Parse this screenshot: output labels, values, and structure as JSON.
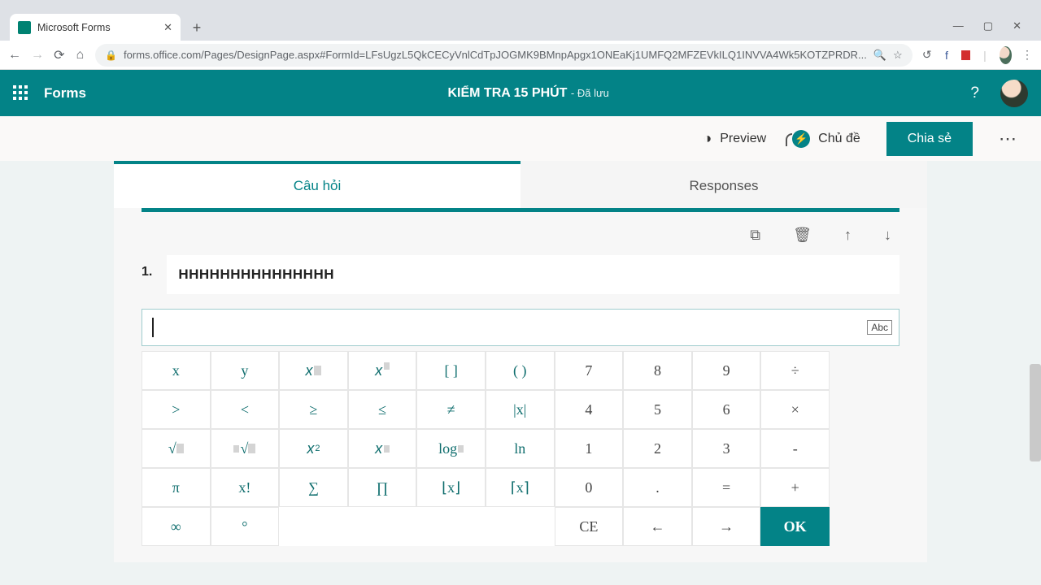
{
  "browser": {
    "tab_title": "Microsoft Forms",
    "url": "forms.office.com/Pages/DesignPage.aspx#FormId=LFsUgzL5QkCECyVnlCdTpJOGMK9BMnpApgx1ONEaKj1UMFQ2MFZEVkILQ1INVVA4Wk5KOTZPRDR..."
  },
  "app": {
    "name": "Forms",
    "form_title": "KIỂM TRA 15 PHÚT",
    "saved_label": "- Đã lưu"
  },
  "actions": {
    "preview": "Preview",
    "theme": "Chủ đề",
    "share": "Chia sẻ"
  },
  "tabs": {
    "questions": "Câu hỏi",
    "responses": "Responses"
  },
  "question": {
    "number": "1.",
    "title": "HHHHHHHHHHHHHHH",
    "abc_chip": "Abc"
  },
  "keys": {
    "r0": [
      "x",
      "y",
      "x▫",
      "x▫",
      "[ ]",
      "( )",
      "7",
      "8",
      "9",
      "÷"
    ],
    "r1": [
      ">",
      "<",
      "≥",
      "≤",
      "≠",
      "|x|",
      "4",
      "5",
      "6",
      "×"
    ],
    "r2": [
      "√▫",
      "▫√▫",
      "x²",
      "x▫",
      "log▫",
      "ln",
      "1",
      "2",
      "3",
      "-"
    ],
    "r3": [
      "π",
      "x!",
      "∑",
      "∏",
      "⌊x⌋",
      "⌈x⌉",
      "0",
      ".",
      "=",
      "+"
    ],
    "r4": [
      "∞",
      "°",
      "",
      "",
      "",
      "",
      "CE",
      "←",
      "→",
      "OK"
    ]
  },
  "key_names": {
    "r0": [
      "var-x",
      "var-y",
      "x-sub",
      "x-sup",
      "brackets",
      "parens",
      "digit-7",
      "digit-8",
      "digit-9",
      "divide"
    ],
    "r1": [
      "gt",
      "lt",
      "gte",
      "lte",
      "neq",
      "abs",
      "digit-4",
      "digit-5",
      "digit-6",
      "multiply"
    ],
    "r2": [
      "sqrt",
      "nth-root",
      "x-squared",
      "x-power",
      "log",
      "ln",
      "digit-1",
      "digit-2",
      "digit-3",
      "minus"
    ],
    "r3": [
      "pi",
      "factorial",
      "sum",
      "product",
      "floor",
      "ceil",
      "digit-0",
      "decimal",
      "equals",
      "plus"
    ],
    "r4": [
      "infinity",
      "degree",
      "blank",
      "blank",
      "blank",
      "blank",
      "clear",
      "arrow-left",
      "arrow-right",
      "ok"
    ]
  }
}
